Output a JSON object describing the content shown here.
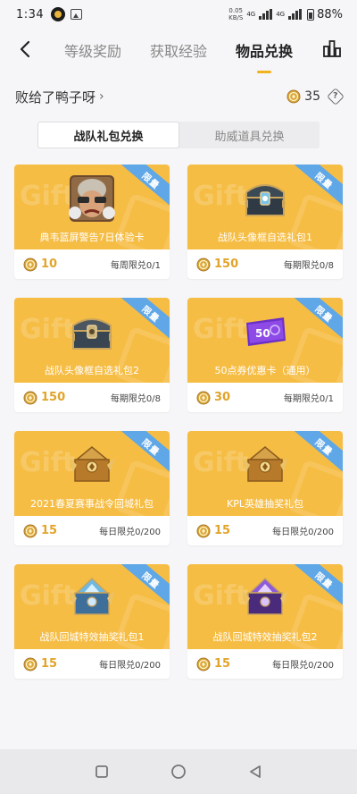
{
  "status_bar": {
    "time": "1:34",
    "net_speed_value": "0.05",
    "net_speed_unit": "KB/S",
    "signal1": "4G",
    "signal2": "4G",
    "battery": "88%"
  },
  "header": {
    "tabs": [
      {
        "label": "等级奖励"
      },
      {
        "label": "获取经验"
      },
      {
        "label": "物品兑换"
      }
    ],
    "active_tab": 2
  },
  "user": {
    "name": "败给了鸭子呀",
    "coins": "35"
  },
  "segment": {
    "options": [
      {
        "label": "战队礼包兑换"
      },
      {
        "label": "助威道具兑换"
      }
    ],
    "selected": 0
  },
  "ribbon_label": "限量",
  "watermark": "Gift",
  "items": [
    {
      "title": "典韦蓝屏警告7日体验卡",
      "price": "10",
      "limit": "每周限兑0/1",
      "icon": "hero-avatar"
    },
    {
      "title": "战队头像框自选礼包1",
      "price": "150",
      "limit": "每期限兑0/8",
      "icon": "treasure-chest"
    },
    {
      "title": "战队头像框自选礼包2",
      "price": "150",
      "limit": "每期限兑0/8",
      "icon": "treasure-chest"
    },
    {
      "title": "50点券优惠卡（通用）",
      "price": "30",
      "limit": "每期限兑0/1",
      "icon": "coupon-card",
      "coupon_text": "50"
    },
    {
      "title": "2021春夏赛事战令回城礼包",
      "price": "15",
      "limit": "每日限兑0/200",
      "icon": "gold-chest"
    },
    {
      "title": "KPL英雄抽奖礼包",
      "price": "15",
      "limit": "每日限兑0/200",
      "icon": "gold-chest"
    },
    {
      "title": "战队回城特效抽奖礼包1",
      "price": "15",
      "limit": "每日限兑0/200",
      "icon": "blue-chest"
    },
    {
      "title": "战队回城特效抽奖礼包2",
      "price": "15",
      "limit": "每日限兑0/200",
      "icon": "purple-chest"
    }
  ],
  "colors": {
    "card_banner": "#f6bd45",
    "ribbon": "#5fa7e6",
    "accent": "#f2b21d",
    "price": "#e2a42a"
  }
}
